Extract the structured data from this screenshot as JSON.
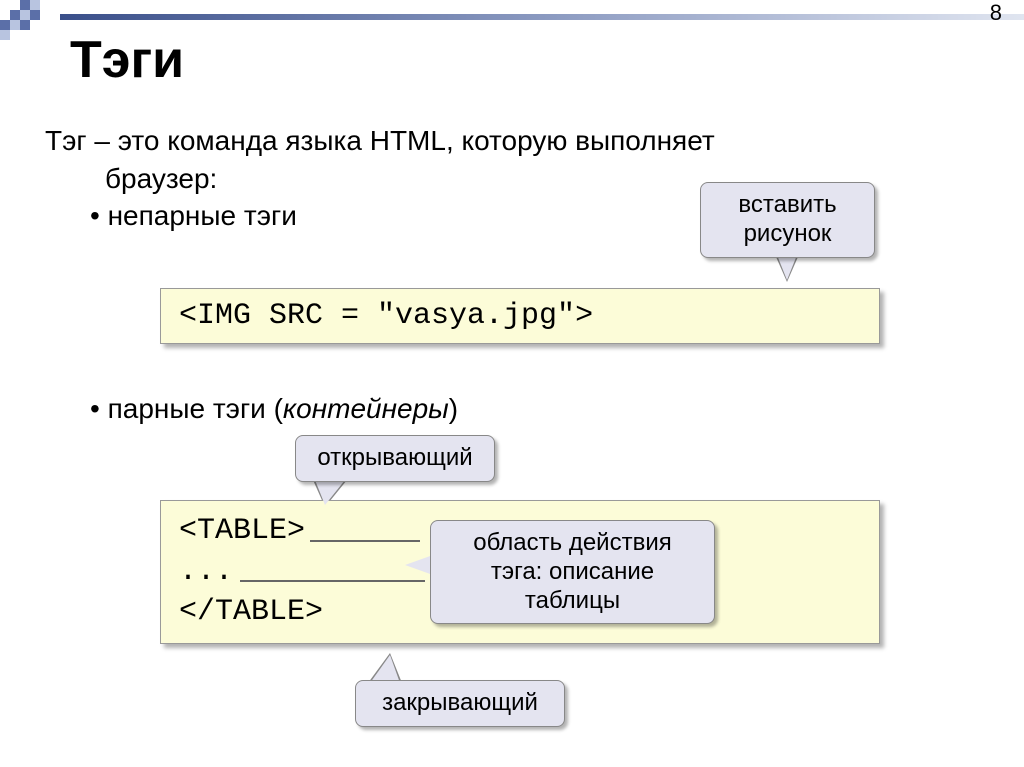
{
  "page_number": "8",
  "title": "Тэги",
  "intro_line1": "Тэг – это команда языка HTML, которую выполняет",
  "intro_line2_indent": "браузер:",
  "bullet1": "непарные тэги",
  "code1": "<IMG SRC = \"vasya.jpg\">",
  "bullet2_part1": "парные тэги (",
  "bullet2_italic": "контейнеры",
  "bullet2_part2": ")",
  "code2_line1": "<TABLE>",
  "code2_line2": "...",
  "code2_line3": "</TABLE>",
  "callouts": {
    "insert": "вставить рисунок",
    "open": "открывающий",
    "area": "область действия тэга: описание таблицы",
    "close": "закрывающий"
  }
}
